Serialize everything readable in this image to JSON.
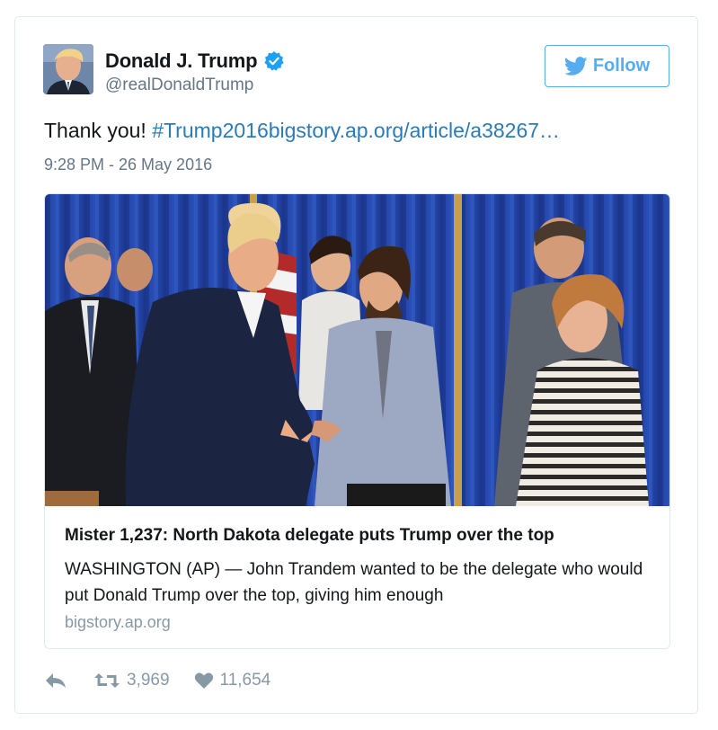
{
  "user": {
    "display_name": "Donald J. Trump",
    "screen_name": "@realDonaldTrump",
    "verified": true,
    "avatar_icon": "profile-photo"
  },
  "follow_button": {
    "label": "Follow",
    "icon": "twitter-bird-icon"
  },
  "tweet": {
    "text": "Thank you! ",
    "link_text": "#Trump2016bigstory.ap.org/article/a38267…",
    "timestamp": "9:28 PM - 26 May 2016"
  },
  "card": {
    "image_description": "photo-handshake",
    "title": "Mister 1,237: North Dakota delegate puts Trump over the top",
    "description": "WASHINGTON (AP) — John Trandem wanted to be the delegate who would put Donald Trump over the top, giving him enough",
    "domain": "bigstory.ap.org"
  },
  "actions": {
    "reply_icon": "reply-icon",
    "retweet_icon": "retweet-icon",
    "retweet_count": "3,969",
    "like_icon": "heart-icon",
    "like_count": "11,654"
  },
  "colors": {
    "link": "#2b7bb9",
    "accent": "#55acee",
    "muted": "#657786",
    "border": "#e1e8ed"
  }
}
